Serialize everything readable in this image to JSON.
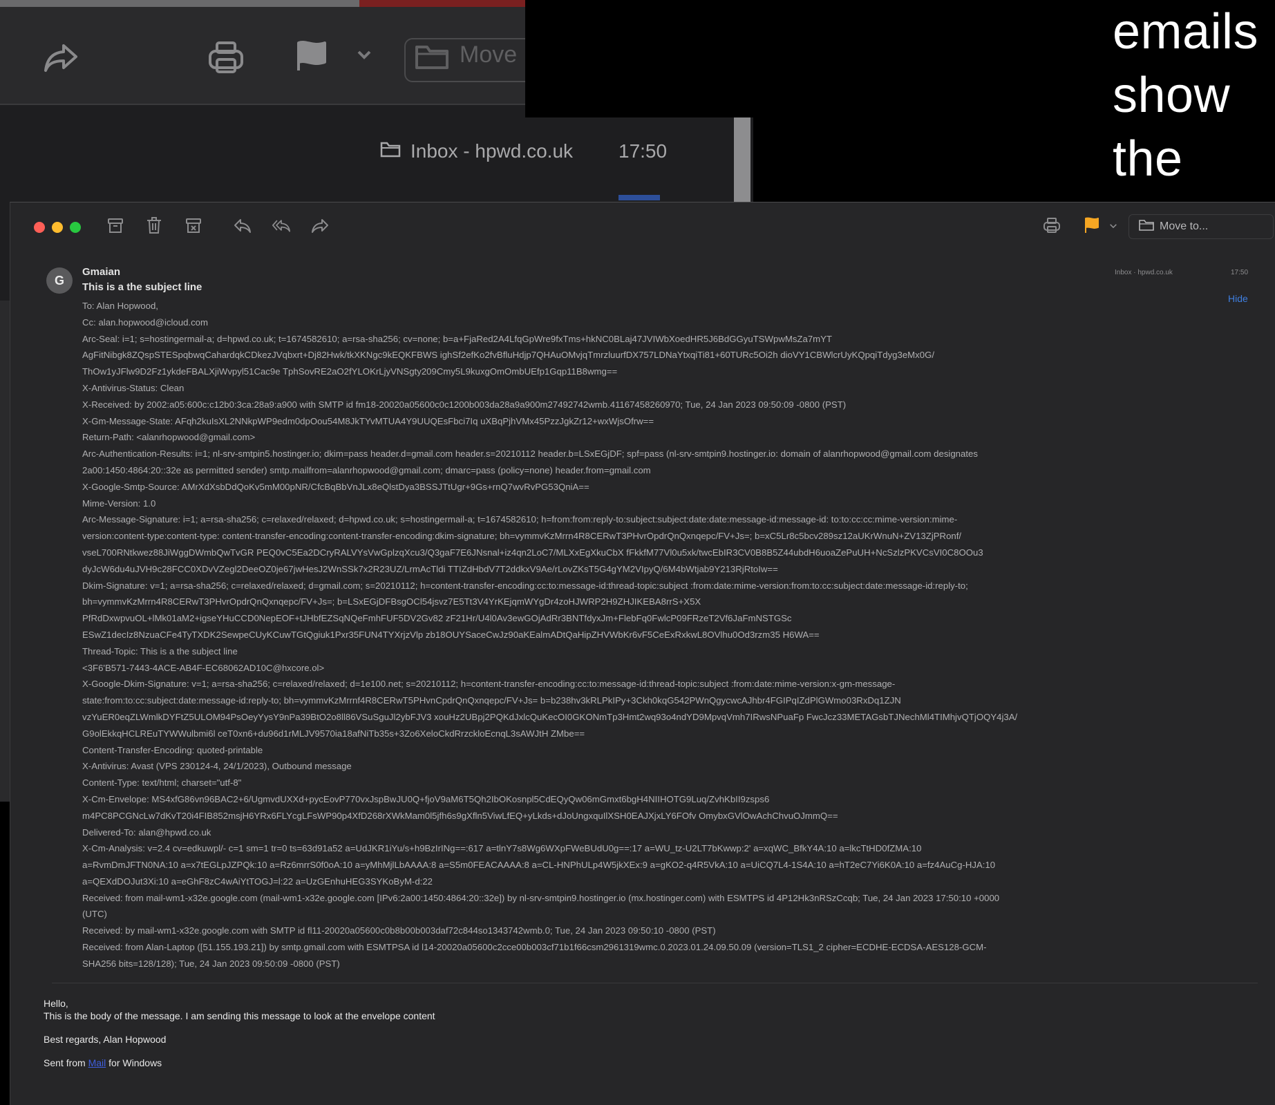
{
  "caption": "emails show the content",
  "background_window": {
    "move_label": "Move",
    "folder_label": "Inbox - hpwd.co.uk",
    "time": "17:50"
  },
  "window": {
    "move_label": "Move to...",
    "sender": "Gmaian",
    "subject": "This is a the subject line",
    "mini_inbox": "Inbox · hpwd.co.uk",
    "mini_time": "17:50",
    "hide_label": "Hide",
    "avatar_letter": "G"
  },
  "header_lines": [
    "To:  Alan Hopwood,",
    "Cc:  alan.hopwood@icloud.com",
    "Arc-Seal: i=1; s=hostingermail-a; d=hpwd.co.uk; t=1674582610; a=rsa-sha256; cv=none; b=a+FjaRed2A4LfqGpWre9fxTms+hkNC0BLaj47JVIWbXoedHR5J6BdGGyuTSWpwMsZa7mYT",
    "AgFitNibgk8ZQspSTESpqbwqCahardqkCDkezJVqbxrt+Dj82Hwk/tkXKNgc9kEQKFBWS ighSf2efKo2fvBfluHdjp7QHAuOMvjqTmrzluurfDX757LDNaYtxqiTi81+60TURc5Oi2h dioVY1CBWlcrUyKQpqiTdyg3eMx0G/",
    "ThOw1yJFlw9D2Fz1ykdeFBALXjiWvpyl51Cac9e TphSovRE2aO2fYLOKrLjyVNSgty209Cmy5L9kuxgOmOmbUEfp1Gqp11B8wmg==",
    "X-Antivirus-Status: Clean",
    "X-Received: by 2002:a05:600c:c12b0:3ca:28a9:a900 with SMTP id fm18-20020a05600c0c1200b003da28a9a900m27492742wmb.41167458260970; Tue, 24 Jan 2023 09:50:09 -0800 (PST)",
    "X-Gm-Message-State: AFqh2kuIsXL2NNkpWP9edm0dpOou54M8JkTYvMTUA4Y9UUQEsFbci7Iq uXBqPjhVMx45PzzJgkZr12+wxWjsOfrw==",
    "Return-Path: <alanrhopwood@gmail.com>",
    "Arc-Authentication-Results: i=1; nl-srv-smtpin5.hostinger.io; dkim=pass header.d=gmail.com header.s=20210112 header.b=LSxEGjDF; spf=pass (nl-srv-smtpin9.hostinger.io: domain of alanrhopwood@gmail.com designates",
    "2a00:1450:4864:20::32e as permitted sender) smtp.mailfrom=alanrhopwood@gmail.com; dmarc=pass (policy=none) header.from=gmail.com",
    "X-Google-Smtp-Source: AMrXdXsbDdQoKv5mM00pNR/CfcBqBbVnJLx8eQlstDya3BSSJTtUgr+9Gs+rnQ7wvRvPG53QniA==",
    "Mime-Version: 1.0",
    "Arc-Message-Signature: i=1; a=rsa-sha256; c=relaxed/relaxed; d=hpwd.co.uk; s=hostingermail-a; t=1674582610; h=from:from:reply-to:subject:subject:date:date:message-id:message-id: to:to:cc:cc:mime-version:mime-",
    "version:content-type:content-type: content-transfer-encoding:content-transfer-encoding:dkim-signature; bh=vymmvKzMrrn4R8CERwT3PHvrOpdrQnQxnqepc/FV+Js=; b=xC5Lr8c5bcv289sz12aUKrWnuN+ZV13ZjPRonf/",
    "vseL700RNtkwez88JiWggDWmbQwTvGR PEQ0vC5Ea2DCryRALVYsVwGplzqXcu3/Q3gaF7E6JNsnal+iz4qn2LoC7/MLXxEgXkuCbX fFkkfM77Vl0u5xk/twcEbIR3CV0B8B5Z44ubdH6uoaZePuUH+NcSzlzPKVCsVI0C8OOu3",
    "dyJcW6du4uJVH9c28FCC0XDvVZegl2DeeOZ0je67jwHesJ2WnSSk7x2R23UZ/LrmAcTldi TTIZdHbdV7T2ddkxV9Ae/rLovZKsT5G4gYM2VIpyQ/6M4bWtjab9Y213RjRtoIw==",
    "Dkim-Signature: v=1; a=rsa-sha256; c=relaxed/relaxed; d=gmail.com; s=20210112; h=content-transfer-encoding:cc:to:message-id:thread-topic:subject :from:date:mime-version:from:to:cc:subject:date:message-id:reply-to;",
    "bh=vymmvKzMrrn4R8CERwT3PHvrOpdrQnQxnqepc/FV+Js=; b=LSxEGjDFBsgOCl54jsvz7E5Tt3V4YrKEjqmWYgDr4zoHJWRP2H9ZHJIKEBA8rrS+X5X",
    "PfRdDxwpvuOL+lMk01aM2+igseYHuCCD0NepEOF+tJHbfEZSqNQeFmhFUF5DV2Gv82 zF21Hr/U4l0Av3ewGOjAdRr3BNTfdyxJm+FlebFq0FwlcP09FRzeT2Vf6JaFmNSTGSc",
    "ESwZ1decIz8NzuaCFe4TyTXDK2SewpeCUyKCuwTGtQgiuk1Pxr35FUN4TYXrjzVlp zb18OUYSaceCwJz90aKEalmADtQaHipZHVWbKr6vF5CeExRxkwL8OVlhu0Od3rzm35 H6WA==",
    "Thread-Topic: This is a the subject line",
    "<3F6'B571-7443-4ACE-AB4F-EC68062AD10C@hxcore.ol>",
    "X-Google-Dkim-Signature: v=1; a=rsa-sha256; c=relaxed/relaxed; d=1e100.net; s=20210112; h=content-transfer-encoding:cc:to:message-id:thread-topic:subject :from:date:mime-version:x-gm-message-",
    "state:from:to:cc:subject:date:message-id:reply-to; bh=vymmvKzMrrnf4R8CERwT5PHvnCpdrQnQxnqepc/FV+Js= b=b238hv3kRLPkIPy+3Ckh0kqG542PWnQgycwcAJhbr4FGIPqIZdPlGWmo03RxDq1ZJN",
    "vzYuER0eqZLWmlkDYFtZ5ULOM94PsOeyYysY9nPa39BtO2o8ll86VSuSguJl2ybFJV3 xouHz2UBpj2PQKdJxlcQuKecOI0GKONmTp3Hmt2wq93o4ndYD9MpvqVmh7IRwsNPuaFp FwcJcz33METAGsbTJNechMl4TIMhjvQTjOQY4j3A/",
    "G9olEkkqHCLREuTYWWulbmi6l ceT0xn6+du96d1rMLJV9570ia18afNiTb35s+3Zo6XeloCkdRrzckloEcnqL3sAWJtH ZMbe==",
    "Content-Transfer-Encoding: quoted-printable",
    "X-Antivirus: Avast (VPS 230124-4, 24/1/2023), Outbound message",
    "Content-Type: text/html; charset=\"utf-8\"",
    "X-Cm-Envelope: MS4xfG86vn96BAC2+6/UgmvdUXXd+pycEovP770vxJspBwJU0Q+fjoV9aM6T5Qh2IbOKosnpl5CdEQyQw06mGmxt6bgH4NIIHOTG9Luq/ZvhKbII9zsps6",
    "m4PC8PCGNcLw7dKvT20i4FIB852msjH6YRx6FLYcgLFsWP90p4XfD268rXWkMam0l5jfh6s9gXfln5ViwLfEQ+yLkds+dJoUngxquIlXSH0EAJXjxLY6FOfv OmybxGVlOwAchChvuOJmmQ==",
    "Delivered-To: alan@hpwd.co.uk",
    "X-Cm-Analysis: v=2.4 cv=edkuwpl/- c=1 sm=1 tr=0 ts=63d91a52 a=UdJKR1iYu/s+h9BzIrINg==:617 a=tlnY7s8Wg6WXpFWeBUdU0g==:17 a=WU_tz-U2LT7bKwwp:2' a=xqWC_BfkY4A:10 a=lkcTtHD0fZMA:10",
    "a=RvmDmJFTN0NA:10 a=x7tEGLpJZPQk:10 a=Rz6mrrS0f0oA:10 a=yMhMjlLbAAAA:8 a=S5m0FEACAAAA:8 a=CL-HNPhULp4W5jkXEx:9 a=gKO2-q4R5VkA:10 a=UiCQ7L4-1S4A:10 a=hT2eC7Yi6K0A:10 a=fz4AuCg-HJA:10",
    "a=QEXdDOJut3Xi:10 a=eGhF8zC4wAiYtTOGJ=l:22 a=UzGEnhuHEG3SYKoByM-d:22",
    "Received: from mail-wm1-x32e.google.com (mail-wm1-x32e.google.com [IPv6:2a00:1450:4864:20::32e]) by nl-srv-smtpin9.hostinger.io (mx.hostinger.com) with ESMTPS id 4P12Hk3nRSzCcqb; Tue, 24 Jan 2023 17:50:10 +0000",
    "(UTC)",
    "Received: by mail-wm1-x32e.google.com with SMTP id fl11-20020a05600c0b8b00b003daf72c844so1343742wmb.0; Tue, 24 Jan 2023 09:50:10 -0800 (PST)",
    "Received: from Alan-Laptop ([51.155.193.21]) by smtp.gmail.com with ESMTPSA id l14-20020a05600c2cce00b003cf71b1f66csm2961319wmc.0.2023.01.24.09.50.09 (version=TLS1_2 cipher=ECDHE-ECDSA-AES128-GCM-",
    "SHA256 bits=128/128); Tue, 24 Jan 2023 09:50:09 -0800 (PST)"
  ],
  "body": {
    "greeting": "Hello,",
    "line1": "This is the body of the message.   I am sending this message to look at the envelope content",
    "signoff": "Best regards,  Alan Hopwood",
    "sent_prefix": "Sent from ",
    "sent_link": "Mail",
    "sent_suffix": " for Windows"
  },
  "colors": {
    "traffic_red": "#ff5f57",
    "traffic_yellow": "#febc2e",
    "traffic_green": "#28c840",
    "flag_orange": "#f5a623",
    "link_blue": "#3f7fe0"
  }
}
